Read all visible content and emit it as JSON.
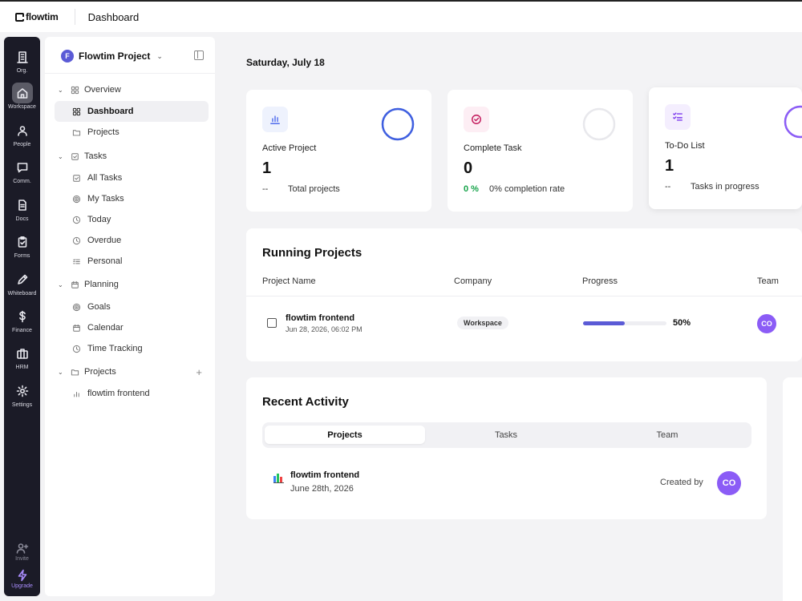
{
  "app": {
    "logo_text": "flowtim",
    "page_title": "Dashboard"
  },
  "rail": [
    {
      "label": "Org.",
      "icon": "building-icon"
    },
    {
      "label": "Workspace",
      "icon": "home-icon",
      "active": true
    },
    {
      "label": "People",
      "icon": "people-icon"
    },
    {
      "label": "Comm.",
      "icon": "chat-icon"
    },
    {
      "label": "Docs",
      "icon": "document-icon"
    },
    {
      "label": "Forms",
      "icon": "clipboard-icon"
    },
    {
      "label": "Whiteboard",
      "icon": "pen-icon"
    },
    {
      "label": "Finance",
      "icon": "dollar-icon"
    },
    {
      "label": "HRM",
      "icon": "briefcase-icon"
    },
    {
      "label": "Settings",
      "icon": "gear-icon"
    }
  ],
  "rail_bottom": [
    {
      "label": "Invite",
      "icon": "user-plus-icon"
    },
    {
      "label": "Upgrade",
      "icon": "lightning-icon"
    }
  ],
  "sidebar": {
    "project_initial": "F",
    "project_name": "Flowtim Project",
    "groups": [
      {
        "label": "Overview",
        "icon": "grid-icon",
        "items": [
          {
            "label": "Dashboard",
            "icon": "grid-icon",
            "active": true
          },
          {
            "label": "Projects",
            "icon": "folder-icon"
          }
        ]
      },
      {
        "label": "Tasks",
        "icon": "checkbox-icon",
        "items": [
          {
            "label": "All Tasks",
            "icon": "checkbox-icon"
          },
          {
            "label": "My Tasks",
            "icon": "target-icon"
          },
          {
            "label": "Today",
            "icon": "clock-icon"
          },
          {
            "label": "Overdue",
            "icon": "clock-icon"
          },
          {
            "label": "Personal",
            "icon": "list-icon"
          }
        ]
      },
      {
        "label": "Planning",
        "icon": "calendar-icon",
        "items": [
          {
            "label": "Goals",
            "icon": "target-icon"
          },
          {
            "label": "Calendar",
            "icon": "calendar-icon"
          },
          {
            "label": "Time Tracking",
            "icon": "clock-icon"
          }
        ]
      },
      {
        "label": "Projects",
        "icon": "folder-icon",
        "add": "+",
        "items": [
          {
            "label": "flowtim frontend",
            "icon": "chart-bars-icon"
          }
        ]
      }
    ]
  },
  "main": {
    "date": "Saturday, July 18",
    "stats": [
      {
        "label": "Active Project",
        "value": "1",
        "foot_prefix": "--",
        "foot_text": "Total projects",
        "icon": "bar-chart-icon",
        "icon_color": "#4f6bed",
        "icon_bg": "#eef2fd",
        "ring_color": "#3f5fe0",
        "ring_progress": 1
      },
      {
        "label": "Complete Task",
        "value": "0",
        "foot_prefix": "0 %",
        "foot_text": "0% completion rate",
        "icon": "check-circle-icon",
        "icon_color": "#c2185b",
        "icon_bg": "#fdeef4",
        "ring_color": "#e6e6ea",
        "ring_progress": 0
      },
      {
        "label": "To-Do List",
        "value": "1",
        "foot_prefix": "--",
        "foot_text": "Tasks in progress",
        "icon": "checklist-icon",
        "icon_color": "#7c3aed",
        "icon_bg": "#f4eefe",
        "ring_color": "#8b5cf6",
        "ring_progress": 1
      }
    ],
    "running_projects": {
      "title": "Running Projects",
      "columns": [
        "Project Name",
        "Company",
        "Progress",
        "Team"
      ],
      "rows": [
        {
          "name": "flowtim frontend",
          "date": "Jun 28, 2026, 06:02 PM",
          "company": "Workspace",
          "progress": 0.5,
          "progress_label": "50%",
          "team": "CO"
        }
      ]
    },
    "recent_activity": {
      "title": "Recent Activity",
      "tabs": [
        "Projects",
        "Tasks",
        "Team"
      ],
      "active_tab": 0,
      "items": [
        {
          "name": "flowtim frontend",
          "date": "June 28th, 2026",
          "by_label": "Created by",
          "by": "CO"
        }
      ]
    },
    "colors": {
      "accent": "#5b5bd6",
      "avatar": "#8b5cf6",
      "success": "#16a34a"
    }
  }
}
